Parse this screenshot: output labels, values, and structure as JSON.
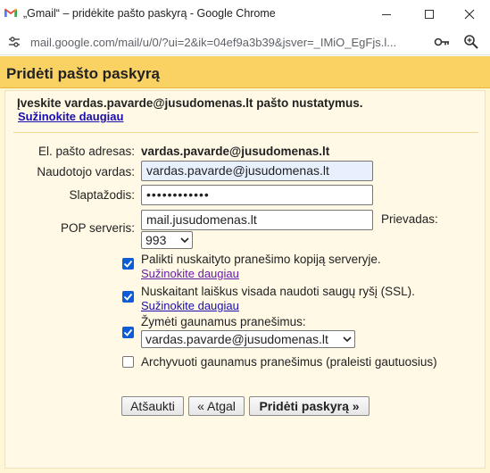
{
  "window": {
    "title": "„Gmail“ – pridėkite pašto paskyrą - Google Chrome",
    "url": "mail.google.com/mail/u/0/?ui=2&ik=04ef9a3b39&jsver=_IMiO_EgFjs.l..."
  },
  "icons": {
    "app": "gmail-logo",
    "site_info": "tune-icon",
    "password": "key-icon",
    "zoom": "zoom-icon"
  },
  "dialog": {
    "title": "Pridėti pašto paskyrą",
    "intro": "Įveskite vardas.pavarde@jusudomenas.lt pašto nustatymus.",
    "learn_more": "Sužinokite daugiau",
    "fields": {
      "email_label": "El. pašto adresas:",
      "email_value": "vardas.pavarde@jusudomenas.lt",
      "username_label": "Naudotojo vardas:",
      "username_value": "vardas.pavarde@jusudomenas.lt",
      "password_label": "Slaptažodis:",
      "password_value": "••••••••••••",
      "pop_label": "POP serveris:",
      "pop_value": "mail.jusudomenas.lt",
      "port_label": "Prievadas:",
      "port_value": "993"
    },
    "options": {
      "leave_copy": {
        "label": "Palikti nuskaityto pranešimo kopiją serveryje.",
        "link": "Sužinokite daugiau",
        "checked": true
      },
      "ssl": {
        "label": "Nuskaitant laiškus visada naudoti saugų ryšį (SSL).",
        "link": "Sužinokite daugiau",
        "checked": true
      },
      "label_incoming": {
        "label": "Žymėti gaunamus pranešimus:",
        "select_value": "vardas.pavarde@jusudomenas.lt",
        "checked": true
      },
      "archive": {
        "label": "Archyvuoti gaunamus pranešimus (praleisti gautuosius)",
        "checked": false
      }
    },
    "buttons": {
      "cancel": "Atšaukti",
      "back": "« Atgal",
      "add": "Pridėti paskyrą »"
    }
  },
  "colors": {
    "header": "#fad163",
    "dialog_bg": "#fff6d6",
    "link": "#1a0dab",
    "visited_link": "#681da8",
    "checkbox": "#0b5cd5"
  }
}
